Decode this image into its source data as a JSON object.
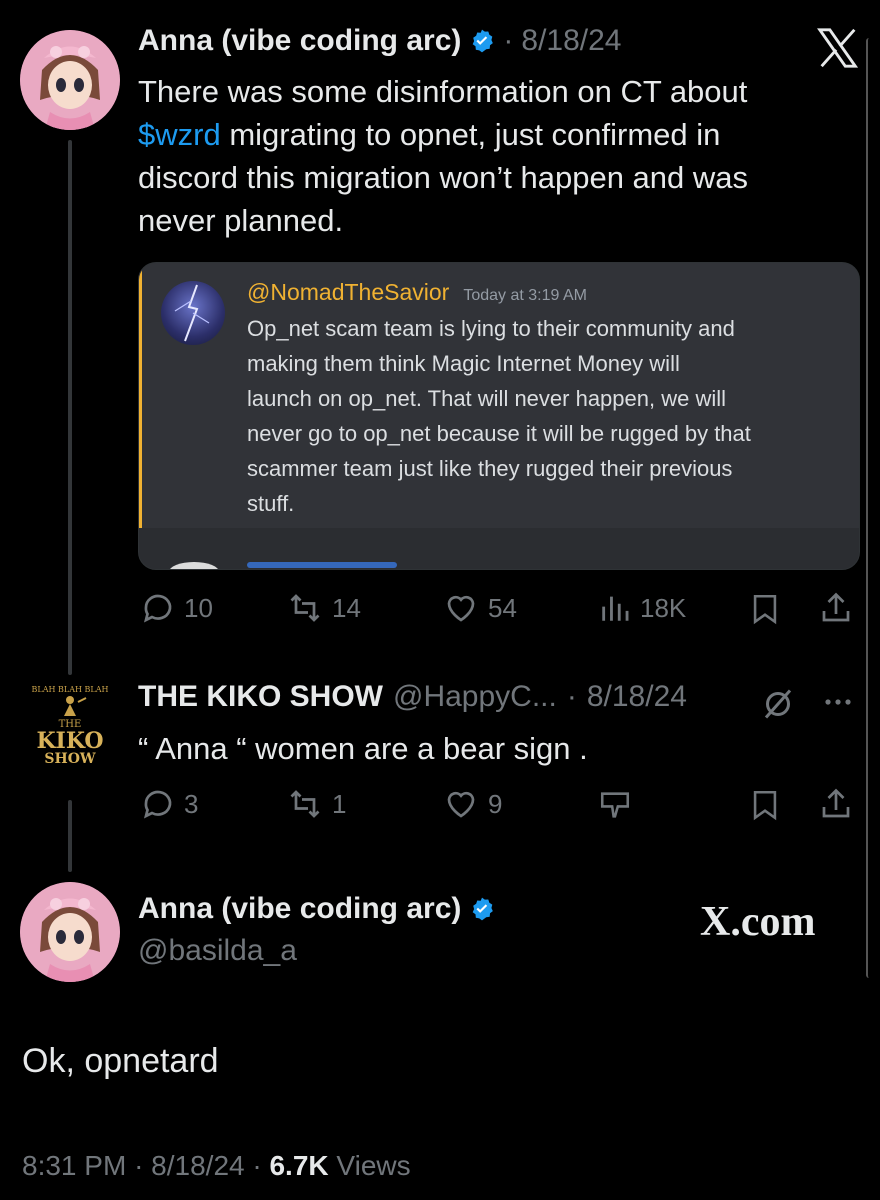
{
  "tweet1": {
    "author": "Anna (vibe coding arc)",
    "date": "8/18/24",
    "text_lines": [
      "There was some disinformation on CT about",
      "migrating to opnet, just confirmed in",
      "discord this migration won’t happen and was",
      "never planned."
    ],
    "cashtag": "$wzrd",
    "embed": {
      "username": "@NomadTheSavior",
      "time": "Today at 3:19 AM",
      "lines": [
        "Op_net scam team is lying to their community and",
        "making them think Magic Internet Money will",
        "launch on op_net. That will never happen, we will",
        "never go to op_net because it will be rugged by that",
        "scammer team just like they rugged their previous",
        "stuff."
      ]
    },
    "actions": {
      "replies": "10",
      "reposts": "14",
      "likes": "54",
      "views": "18K"
    }
  },
  "tweet2": {
    "author": "THE KIKO SHOW",
    "handle": "@HappyC...",
    "date": "8/18/24",
    "text": "“ Anna “ women are a bear sign .",
    "actions": {
      "replies": "3",
      "reposts": "1",
      "likes": "9"
    },
    "avatar_text": {
      "top": "BLAH BLAH BLAH",
      "the": "THE",
      "kiko": "KIKO",
      "show": "SHOW"
    }
  },
  "tweet3": {
    "author": "Anna (vibe coding arc)",
    "handle": "@basilda_a",
    "text": "Ok, opnetard",
    "time": "8:31 PM",
    "date": "8/18/24",
    "views_count": "6.7K",
    "views_label": "Views"
  },
  "watermark": "X.com",
  "colors": {
    "background": "#000000",
    "link": "#1d9bf0",
    "discord_name": "#f0b232",
    "muted": "#71767b"
  }
}
